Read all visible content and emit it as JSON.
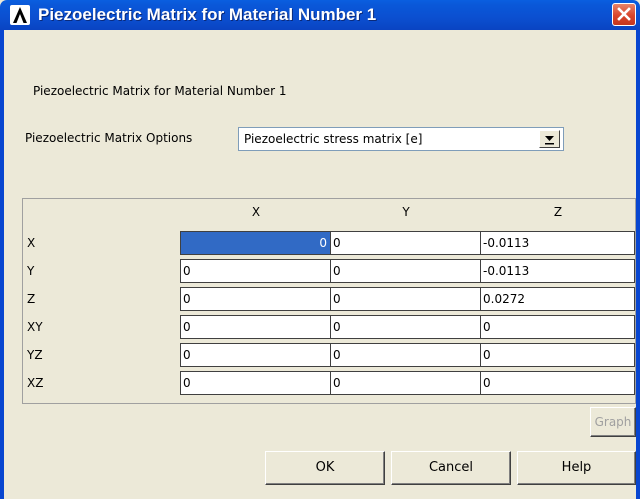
{
  "window": {
    "title": "Piezoelectric Matrix for Material Number 1"
  },
  "heading": "Piezoelectric Matrix for Material Number 1",
  "options": {
    "label": "Piezoelectric Matrix Options",
    "selected": "Piezoelectric stress matrix [e]"
  },
  "matrix": {
    "columns": [
      "X",
      "Y",
      "Z"
    ],
    "rows": [
      {
        "label": "X",
        "values": [
          "0",
          "0",
          "-0.0113"
        ]
      },
      {
        "label": "Y",
        "values": [
          "0",
          "0",
          "-0.0113"
        ]
      },
      {
        "label": "Z",
        "values": [
          "0",
          "0",
          "0.0272"
        ]
      },
      {
        "label": "XY",
        "values": [
          "0",
          "0",
          "0"
        ]
      },
      {
        "label": "YZ",
        "values": [
          "0",
          "0",
          "0"
        ]
      },
      {
        "label": "XZ",
        "values": [
          "0",
          "0",
          "0"
        ]
      }
    ]
  },
  "buttons": {
    "graph": "Graph",
    "ok": "OK",
    "cancel": "Cancel",
    "help": "Help"
  },
  "colors": {
    "title_bar": "#0a58d9",
    "selected_cell": "#316ac5",
    "dialog_bg": "#ece9d8"
  }
}
